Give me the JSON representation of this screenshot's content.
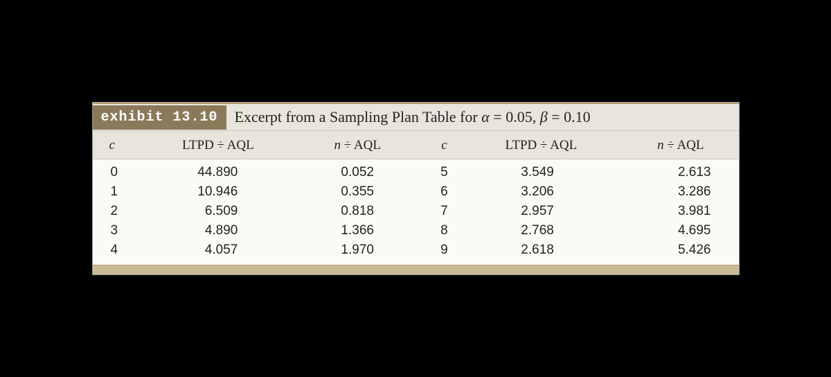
{
  "exhibit": {
    "badge": "exhibit 13.10",
    "title_prefix": "Excerpt from a Sampling Plan Table for ",
    "alpha_sym": "α",
    "alpha_eq": " = 0.05, ",
    "beta_sym": "β",
    "beta_eq": " = 0.10"
  },
  "headers": {
    "c": "c",
    "ltpd": "LTPD ÷ AQL",
    "naql_n": "n",
    "naql_rest": " ÷ AQL"
  },
  "rows": [
    {
      "c1": "0",
      "l1": "44.890",
      "n1": "0.052",
      "c2": "5",
      "l2": "3.549",
      "n2": "2.613"
    },
    {
      "c1": "1",
      "l1": "10.946",
      "n1": "0.355",
      "c2": "6",
      "l2": "3.206",
      "n2": "3.286"
    },
    {
      "c1": "2",
      "l1": "6.509",
      "n1": "0.818",
      "c2": "7",
      "l2": "2.957",
      "n2": "3.981"
    },
    {
      "c1": "3",
      "l1": "4.890",
      "n1": "1.366",
      "c2": "8",
      "l2": "2.768",
      "n2": "4.695"
    },
    {
      "c1": "4",
      "l1": "4.057",
      "n1": "1.970",
      "c2": "9",
      "l2": "2.618",
      "n2": "5.426"
    }
  ]
}
